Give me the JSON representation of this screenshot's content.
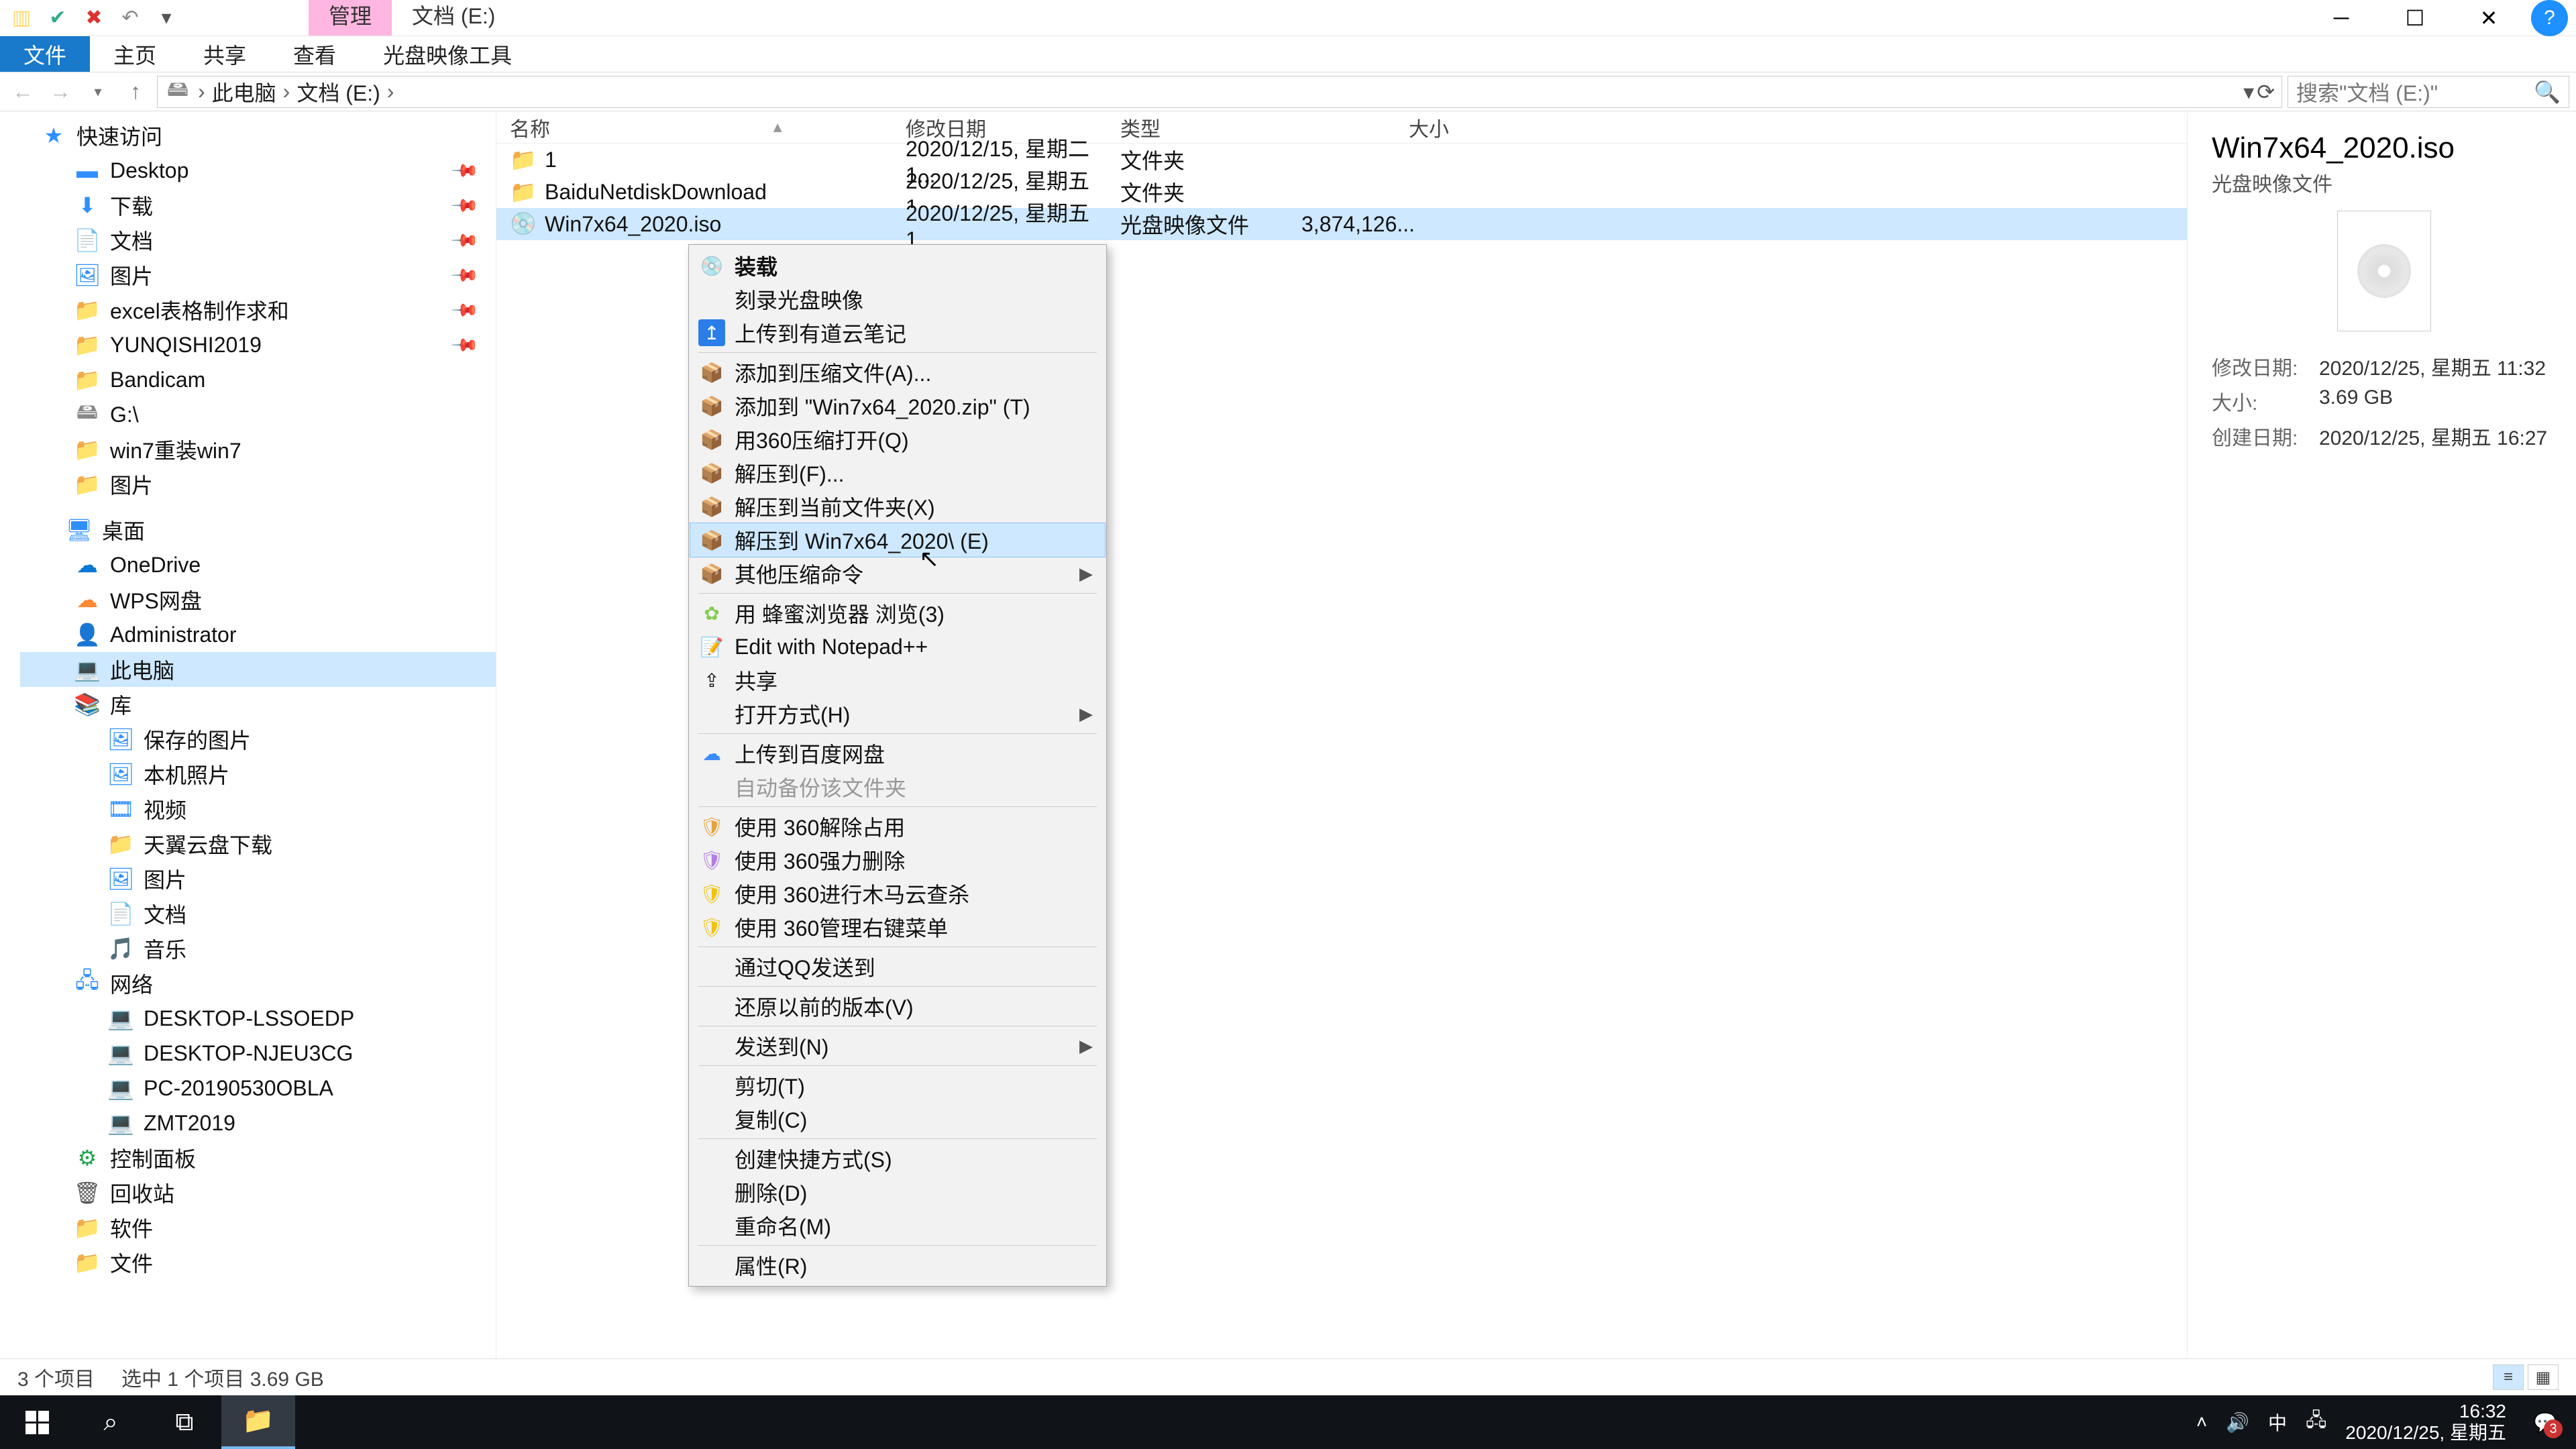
{
  "titlebar": {
    "tab_manage": "管理",
    "tab_location": "文档 (E:)"
  },
  "ribbon": {
    "file": "文件",
    "home": "主页",
    "share": "共享",
    "view": "查看",
    "disctools": "光盘映像工具"
  },
  "nav": {
    "crumb_pc": "此电脑",
    "crumb_drive": "文档 (E:)",
    "search_placeholder": "搜索\"文档 (E:)\""
  },
  "tree": {
    "quick": "快速访问",
    "desktop": "Desktop",
    "downloads": "下载",
    "docs": "文档",
    "pictures": "图片",
    "excel": "excel表格制作求和",
    "yunqishi": "YUNQISHI2019",
    "bandicam": "Bandicam",
    "gdrive": "G:\\",
    "win7": "win7重装win7",
    "pictures2": "图片",
    "desktop2": "桌面",
    "onedrive": "OneDrive",
    "wps": "WPS网盘",
    "admin": "Administrator",
    "thispc": "此电脑",
    "library": "库",
    "savedpics": "保存的图片",
    "localphotos": "本机照片",
    "videos": "视频",
    "tianyi": "天翼云盘下载",
    "pictures3": "图片",
    "docs2": "文档",
    "music": "音乐",
    "network": "网络",
    "net1": "DESKTOP-LSSOEDP",
    "net2": "DESKTOP-NJEU3CG",
    "net3": "PC-20190530OBLA",
    "net4": "ZMT2019",
    "controlpanel": "控制面板",
    "recycle": "回收站",
    "software": "软件",
    "files": "文件"
  },
  "columns": {
    "name": "名称",
    "date": "修改日期",
    "type": "类型",
    "size": "大小"
  },
  "rows": [
    {
      "name": "1",
      "date": "2020/12/15, 星期二 1...",
      "type": "文件夹",
      "size": ""
    },
    {
      "name": "BaiduNetdiskDownload",
      "date": "2020/12/25, 星期五 1...",
      "type": "文件夹",
      "size": ""
    },
    {
      "name": "Win7x64_2020.iso",
      "date": "2020/12/25, 星期五 1...",
      "type": "光盘映像文件",
      "size": "3,874,126..."
    }
  ],
  "preview": {
    "title": "Win7x64_2020.iso",
    "subtitle": "光盘映像文件",
    "mod_label": "修改日期:",
    "mod_value": "2020/12/25, 星期五 11:32",
    "size_label": "大小:",
    "size_value": "3.69 GB",
    "created_label": "创建日期:",
    "created_value": "2020/12/25, 星期五 16:27"
  },
  "ctx": {
    "mount": "装载",
    "burn": "刻录光盘映像",
    "youdao": "上传到有道云笔记",
    "addarchive": "添加到压缩文件(A)...",
    "addzip": "添加到 \"Win7x64_2020.zip\" (T)",
    "open360": "用360压缩打开(Q)",
    "extractto": "解压到(F)...",
    "extracthere": "解压到当前文件夹(X)",
    "extractfolder": "解压到 Win7x64_2020\\ (E)",
    "othercompress": "其他压缩命令",
    "honey": "用 蜂蜜浏览器 浏览(3)",
    "notepad": "Edit with Notepad++",
    "share": "共享",
    "openwith": "打开方式(H)",
    "baidu": "上传到百度网盘",
    "autobak": "自动备份该文件夹",
    "u360unlock": "使用 360解除占用",
    "u360force": "使用 360强力删除",
    "u360trojan": "使用 360进行木马云查杀",
    "u360menu": "使用 360管理右键菜单",
    "qq": "通过QQ发送到",
    "restore": "还原以前的版本(V)",
    "sendto": "发送到(N)",
    "cut": "剪切(T)",
    "copy": "复制(C)",
    "shortcut": "创建快捷方式(S)",
    "delete": "删除(D)",
    "rename": "重命名(M)",
    "properties": "属性(R)"
  },
  "status": {
    "count": "3 个项目",
    "selected": "选中 1 个项目  3.69 GB"
  },
  "taskbar": {
    "ime": "中",
    "time": "16:32",
    "date": "2020/12/25, 星期五",
    "notif_count": "3"
  }
}
